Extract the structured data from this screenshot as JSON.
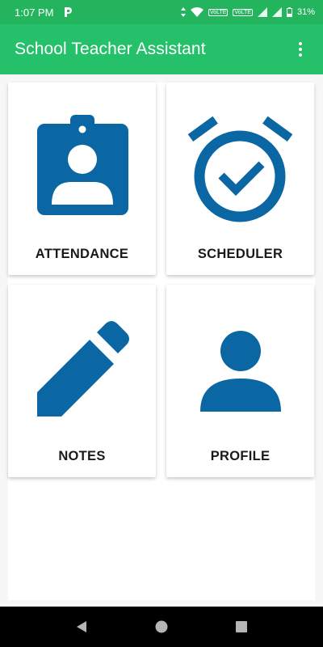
{
  "status_bar": {
    "time": "1:07 PM",
    "battery": "31%",
    "sim1_label": "VoLTE",
    "sim2_label": "VoLTE"
  },
  "app_bar": {
    "title": "School Teacher Assistant",
    "menu_icon": "overflow-menu-icon"
  },
  "cards": [
    {
      "label": "ATTENDANCE",
      "icon": "id-badge-icon"
    },
    {
      "label": "SCHEDULER",
      "icon": "alarm-clock-check-icon"
    },
    {
      "label": "NOTES",
      "icon": "pencil-icon"
    },
    {
      "label": "PROFILE",
      "icon": "person-icon"
    }
  ],
  "colors": {
    "status_bar": "#24b45e",
    "app_bar": "#25c16a",
    "icon_blue": "#0a67a3"
  },
  "nav_bar": {
    "back": "back-icon",
    "home": "home-icon",
    "recents": "recents-icon"
  }
}
